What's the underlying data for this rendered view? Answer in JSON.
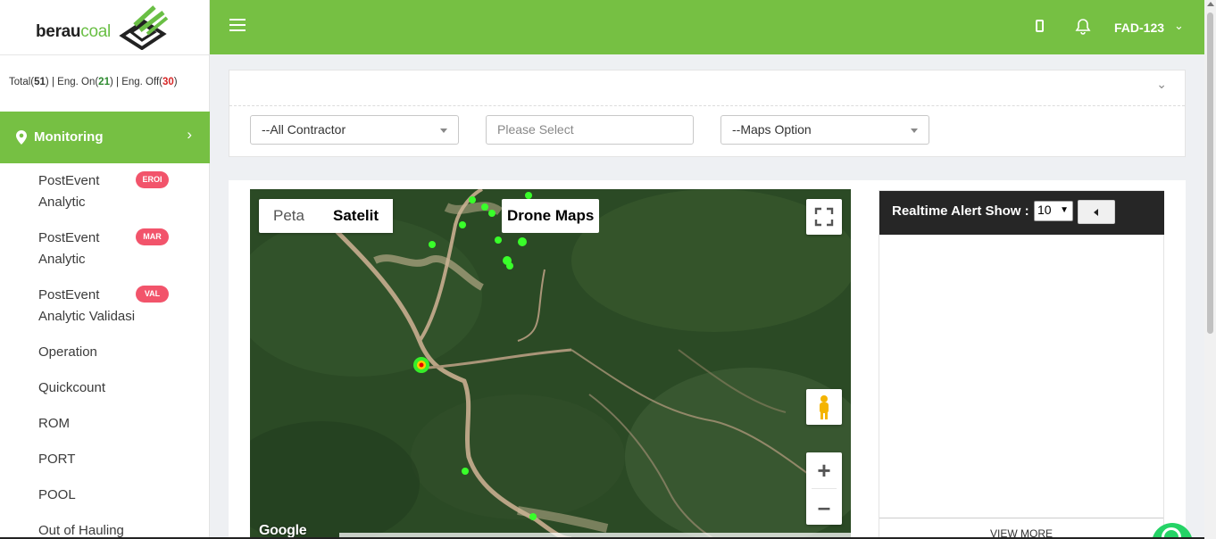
{
  "brand": {
    "word1": "berau",
    "word2": "coal"
  },
  "counts": {
    "total_label": "Total(",
    "total": "51",
    "total_end": ")",
    "sep1": " | Eng. On(",
    "on": "21",
    "on_end": ")",
    "sep2": " | Eng. Off(",
    "off": "30",
    "off_end": ")"
  },
  "sidebar": {
    "active": {
      "label": "Monitoring",
      "icon": "map-pin-icon"
    },
    "items": [
      {
        "label_line1": "PostEvent",
        "label_line2": "Analytic",
        "badge": "EROI"
      },
      {
        "label_line1": "PostEvent",
        "label_line2": "Analytic",
        "badge": "MAR"
      },
      {
        "label_line1": "PostEvent",
        "label_line2": "Analytic Validasi",
        "badge": "VAL"
      },
      {
        "label_line1": "Operation"
      },
      {
        "label_line1": "Quickcount"
      },
      {
        "label_line1": "ROM"
      },
      {
        "label_line1": "PORT"
      },
      {
        "label_line1": "POOL"
      },
      {
        "label_line1": "Out of Hauling"
      }
    ]
  },
  "topbar": {
    "user": "FAD-123",
    "colors": {
      "accent": "#76c043"
    }
  },
  "filters": {
    "contractor": "--All Contractor",
    "select_placeholder": "Please Select",
    "maps_option": "--Maps Option"
  },
  "map": {
    "type_buttons": [
      "Peta",
      "Satelit"
    ],
    "selected_type": "Satelit",
    "drone_label": "Drone Maps",
    "google_label": "Google"
  },
  "alerts": {
    "title": "Realtime Alert Show :",
    "count_value": "10",
    "view_more": "VIEW MORE"
  }
}
